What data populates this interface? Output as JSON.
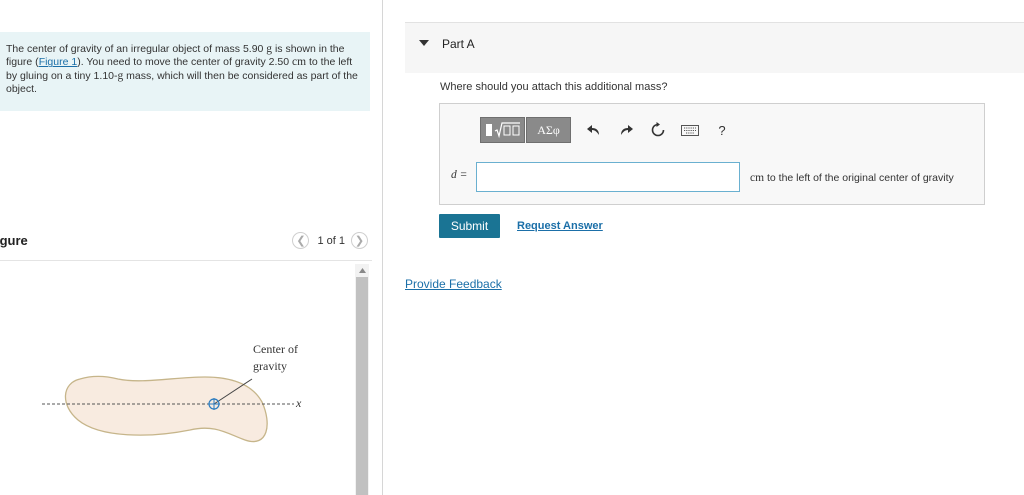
{
  "problem": {
    "text_before_link": "The center of gravity of an irregular object of mass 5.90 ",
    "mass_unit": "g",
    "text_mid1": " is shown in the figure (",
    "link_text": "Figure 1",
    "text_mid2": "). You need to move the center of gravity 2.50 ",
    "dist_unit": "cm",
    "text_mid3": " to the left by gluing on a tiny 1.10-",
    "small_mass_unit": "g",
    "text_end": " mass, which will then be considered as part of the object."
  },
  "figure": {
    "title": "igure",
    "pager_count": "1 of 1",
    "prev_icon": "chevron-left-icon",
    "next_icon": "chevron-right-icon",
    "label_line1": "Center of",
    "label_line2": "gravity",
    "axis_label": "x"
  },
  "part": {
    "title": "Part A",
    "question": "Where should you attach this additional mass?",
    "toolbar": {
      "templates_icon": "templates-icon",
      "symbols_label": "ΑΣφ",
      "undo_icon": "undo-icon",
      "redo_icon": "redo-icon",
      "reset_icon": "reset-icon",
      "keyboard_icon": "keyboard-icon",
      "help_label": "?"
    },
    "variable_label": "d =",
    "answer_value": "",
    "unit_symbol": "cm",
    "unit_suffix": " to the left of the original center of gravity",
    "submit_label": "Submit",
    "request_answer_label": "Request Answer"
  },
  "feedback_label": "Provide Feedback",
  "colors": {
    "accent": "#1a7494",
    "link": "#1b6fa8",
    "problem_bg": "#e8f4f6",
    "shape_fill": "#f8ebe0"
  }
}
